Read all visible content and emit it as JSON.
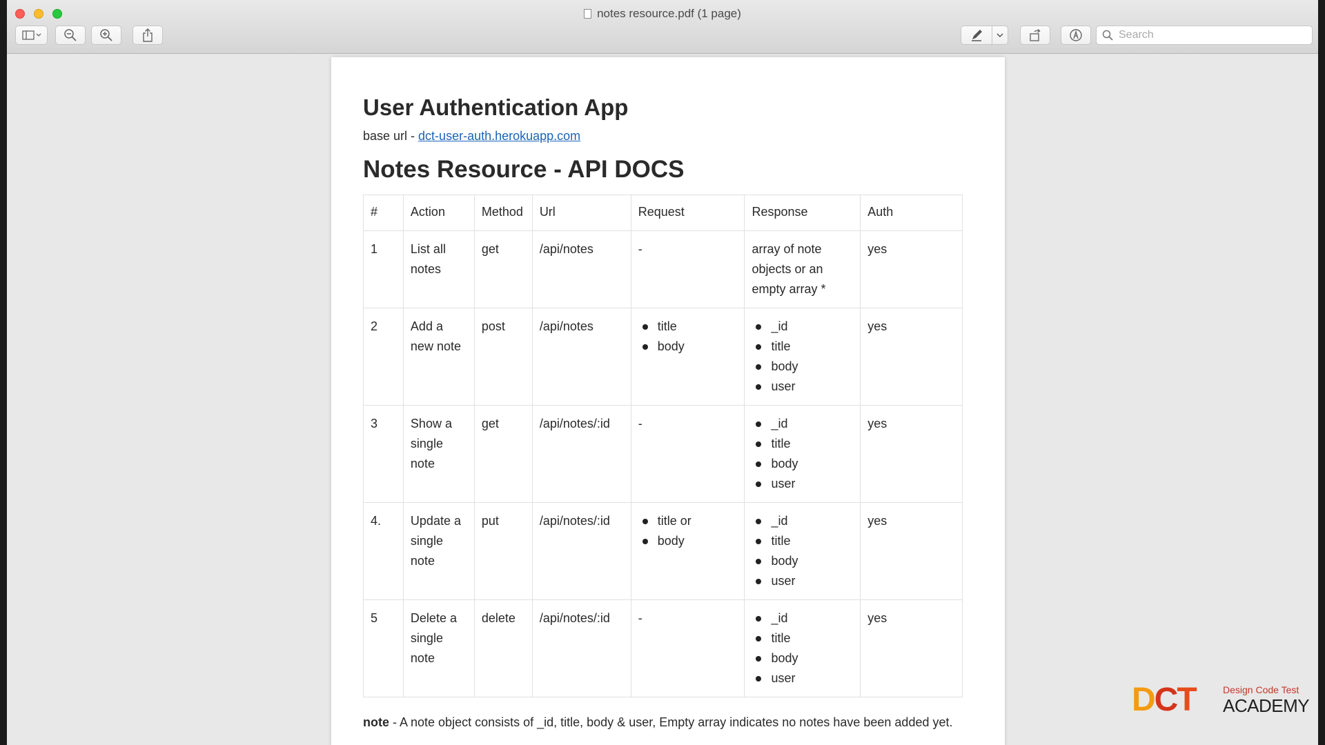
{
  "window": {
    "title": "notes resource.pdf (1 page)"
  },
  "toolbar": {
    "search_placeholder": "Search"
  },
  "doc": {
    "title": "User Authentication App",
    "base_url_label": "base url - ",
    "base_url_link": "dct-user-auth.herokuapp.com",
    "section_title": "Notes Resource - API DOCS",
    "table": {
      "headers": [
        "#",
        "Action",
        "Method",
        "Url",
        "Request",
        "Response",
        "Auth"
      ],
      "rows": [
        {
          "num": "1",
          "action": "List all notes",
          "method": "get",
          "url": "/api/notes",
          "request_text": "-",
          "request_list": [],
          "response_text": "array of note objects  or an empty array *",
          "response_list": [],
          "auth": "yes"
        },
        {
          "num": "2",
          "action": "Add a new note",
          "method": "post",
          "url": "/api/notes",
          "request_text": "",
          "request_list": [
            "title",
            "body"
          ],
          "response_text": "",
          "response_list": [
            "_id",
            "title",
            "body",
            "user"
          ],
          "auth": "yes"
        },
        {
          "num": "3",
          "action": "Show a single note",
          "method": "get",
          "url": "/api/notes/:id",
          "request_text": "-",
          "request_list": [],
          "response_text": "",
          "response_list": [
            "_id",
            "title",
            "body",
            "user"
          ],
          "auth": "yes"
        },
        {
          "num": "4.",
          "action": "Update a single note",
          "method": "put",
          "url": "/api/notes/:id",
          "request_text": "",
          "request_list": [
            "title or",
            "body"
          ],
          "response_text": "",
          "response_list": [
            "_id",
            "title",
            "body",
            "user"
          ],
          "auth": "yes"
        },
        {
          "num": "5",
          "action": "Delete a single note",
          "method": "delete",
          "url": "/api/notes/:id",
          "request_text": "-",
          "request_list": [],
          "response_text": "",
          "response_list": [
            "_id",
            "title",
            "body",
            "user"
          ],
          "auth": "yes"
        }
      ]
    },
    "note_label": "note",
    "note_text": " - A note object consists of _id, title, body & user, Empty array indicates no notes have been added yet."
  },
  "watermark": {
    "logo_letters": "DCT",
    "tagline": "Design Code Test",
    "academy": "ACADEMY"
  }
}
